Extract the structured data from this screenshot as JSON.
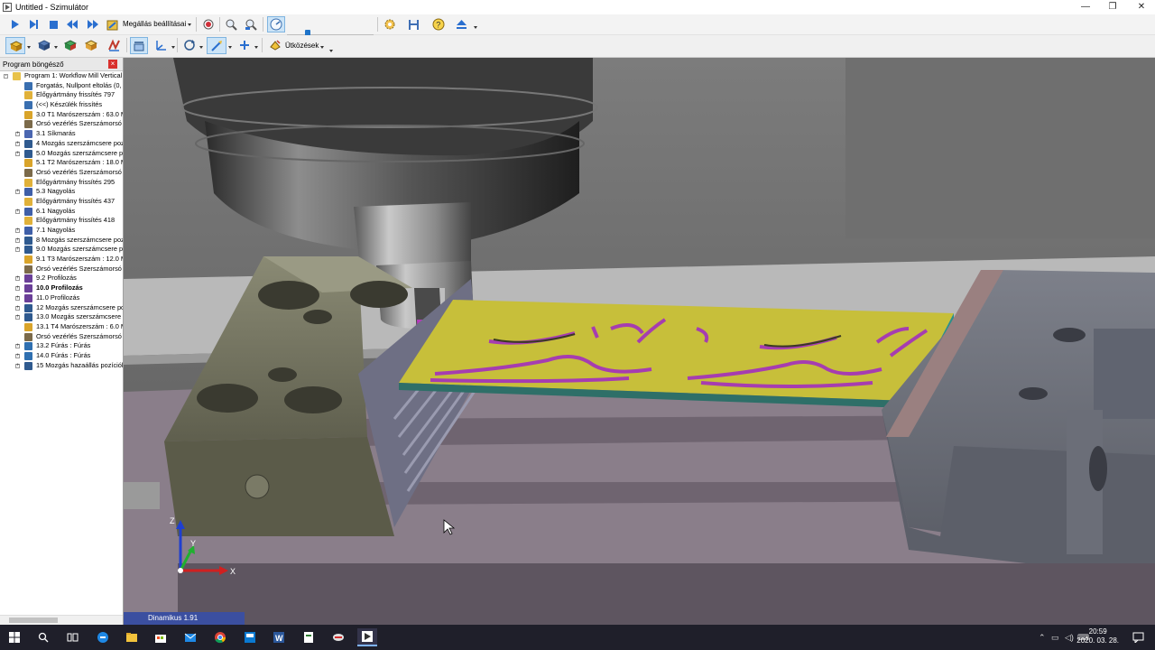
{
  "window": {
    "title": "Untitled - Szimulátor",
    "minimize": "—",
    "restore": "❐",
    "close": "✕"
  },
  "toolbar1": {
    "stop_settings_label": "Megállás beállításai"
  },
  "toolbar2": {
    "collisions_label": "Ütközések"
  },
  "sidebar": {
    "title": "Program böngésző",
    "close": "×",
    "items": [
      {
        "label": "Program 1: Workflow Mill Vertical",
        "level": 0,
        "expander": "-",
        "icon": "program-icon"
      },
      {
        "label": "Forgatás, Nullpont eltolás (0, (",
        "level": 1,
        "expander": "",
        "icon": "rotate-icon"
      },
      {
        "label": "Előgyártmány frissítés 797",
        "level": 1,
        "expander": "",
        "icon": "stock-update-icon"
      },
      {
        "label": "(<<) Készülék frissítés",
        "level": 1,
        "expander": "",
        "icon": "fixture-icon"
      },
      {
        "label": "3.0 T1 Marószerszám : 63.0 M",
        "level": 1,
        "expander": "",
        "icon": "tool-icon"
      },
      {
        "label": "Orsó vezérlés Szerszámorsó E",
        "level": 1,
        "expander": "",
        "icon": "spindle-icon"
      },
      {
        "label": "3.1 Síkmarás",
        "level": 1,
        "expander": "+",
        "icon": "facing-icon"
      },
      {
        "label": "4 Mozgás szerszámcsere poz",
        "level": 1,
        "expander": "+",
        "icon": "move-icon"
      },
      {
        "label": "5.0 Mozgás szerszámcsere po",
        "level": 1,
        "expander": "+",
        "icon": "move-icon"
      },
      {
        "label": "5.1 T2 Marószerszám : 18.0 M",
        "level": 1,
        "expander": "",
        "icon": "tool-icon"
      },
      {
        "label": "Orsó vezérlés Szerszámorsó E",
        "level": 1,
        "expander": "",
        "icon": "spindle-icon"
      },
      {
        "label": "Előgyártmány frissítés 295",
        "level": 1,
        "expander": "",
        "icon": "stock-update-icon"
      },
      {
        "label": "5.3 Nagyolás",
        "level": 1,
        "expander": "+",
        "icon": "roughing-icon"
      },
      {
        "label": "Előgyártmány frissítés 437",
        "level": 1,
        "expander": "",
        "icon": "stock-update-icon"
      },
      {
        "label": "6.1 Nagyolás",
        "level": 1,
        "expander": "+",
        "icon": "roughing-icon"
      },
      {
        "label": "Előgyártmány frissítés 418",
        "level": 1,
        "expander": "",
        "icon": "stock-update-icon"
      },
      {
        "label": "7.1 Nagyolás",
        "level": 1,
        "expander": "+",
        "icon": "roughing-icon"
      },
      {
        "label": "8 Mozgás szerszámcsere poz",
        "level": 1,
        "expander": "+",
        "icon": "move-icon"
      },
      {
        "label": "9.0 Mozgás szerszámcsere po",
        "level": 1,
        "expander": "+",
        "icon": "move-icon"
      },
      {
        "label": "9.1 T3 Marószerszám : 12.0 M",
        "level": 1,
        "expander": "",
        "icon": "tool-icon"
      },
      {
        "label": "Orsó vezérlés Szerszámorsó E",
        "level": 1,
        "expander": "",
        "icon": "spindle-icon"
      },
      {
        "label": "9.2 Profilozás",
        "level": 1,
        "expander": "+",
        "icon": "profiling-icon"
      },
      {
        "label": "10.0 Profilozás",
        "level": 1,
        "expander": "+",
        "icon": "profiling-icon",
        "bold": true
      },
      {
        "label": "11.0 Profilozás",
        "level": 1,
        "expander": "+",
        "icon": "profiling-icon"
      },
      {
        "label": "12 Mozgás szerszámcsere po",
        "level": 1,
        "expander": "+",
        "icon": "move-icon"
      },
      {
        "label": "13.0 Mozgás szerszámcsere p",
        "level": 1,
        "expander": "+",
        "icon": "move-icon"
      },
      {
        "label": "13.1 T4 Marószerszám : 6.0 M",
        "level": 1,
        "expander": "",
        "icon": "tool-icon"
      },
      {
        "label": "Orsó vezérlés Szerszámorsó E",
        "level": 1,
        "expander": "",
        "icon": "spindle-icon"
      },
      {
        "label": "13.2 Fúrás : Fúrás",
        "level": 1,
        "expander": "+",
        "icon": "drilling-icon"
      },
      {
        "label": "14.0 Fúrás : Fúrás",
        "level": 1,
        "expander": "+",
        "icon": "drilling-icon"
      },
      {
        "label": "15 Mozgás hazaállás pozíciól",
        "level": 1,
        "expander": "+",
        "icon": "home-move-icon"
      }
    ]
  },
  "viewport": {
    "axis_z": "Z",
    "axis_y": "Y",
    "axis_x": "X",
    "status": "Dinamikus 1.91"
  },
  "taskbar": {
    "time": "20:59",
    "date": "2020. 03. 28."
  },
  "colors": {
    "accent": "#1e73c8",
    "stock_yellow": "#c7bf3a",
    "toolpath_magenta": "#a63db0",
    "status_blue": "#3b4fa0"
  }
}
